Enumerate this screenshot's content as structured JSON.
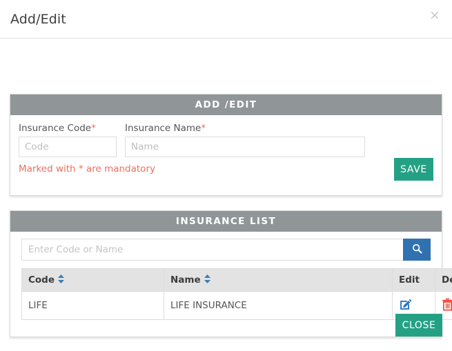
{
  "modal": {
    "title": "Add/Edit",
    "close_icon_label": "×"
  },
  "add_edit_panel": {
    "heading": "ADD /EDIT",
    "code_field": {
      "label": "Insurance Code",
      "required_mark": "*",
      "placeholder": "Code",
      "value": ""
    },
    "name_field": {
      "label": "Insurance Name",
      "required_mark": "*",
      "placeholder": "Name",
      "value": ""
    },
    "mandatory_note": "Marked with * are mandatory",
    "save_label": "SAVE"
  },
  "insurance_list_panel": {
    "heading": "INSURANCE LIST",
    "search": {
      "placeholder": "Enter Code or Name",
      "value": ""
    },
    "table": {
      "columns": [
        "Code",
        "Name",
        "Edit",
        "Delete"
      ],
      "rows": [
        {
          "code": "LIFE",
          "name": "LIFE INSURANCE"
        }
      ]
    }
  },
  "footer": {
    "close_label": "CLOSE"
  },
  "colors": {
    "panel_heading_bg": "#909698",
    "teal_button": "#24a185",
    "search_button_blue": "#3071b0",
    "required_red": "#e8705a",
    "edit_icon_blue": "#2a76c6",
    "delete_icon_red": "#f04a3c",
    "sort_icon_blue": "#3a7eb5",
    "table_header_bg": "#e3e3e3"
  }
}
